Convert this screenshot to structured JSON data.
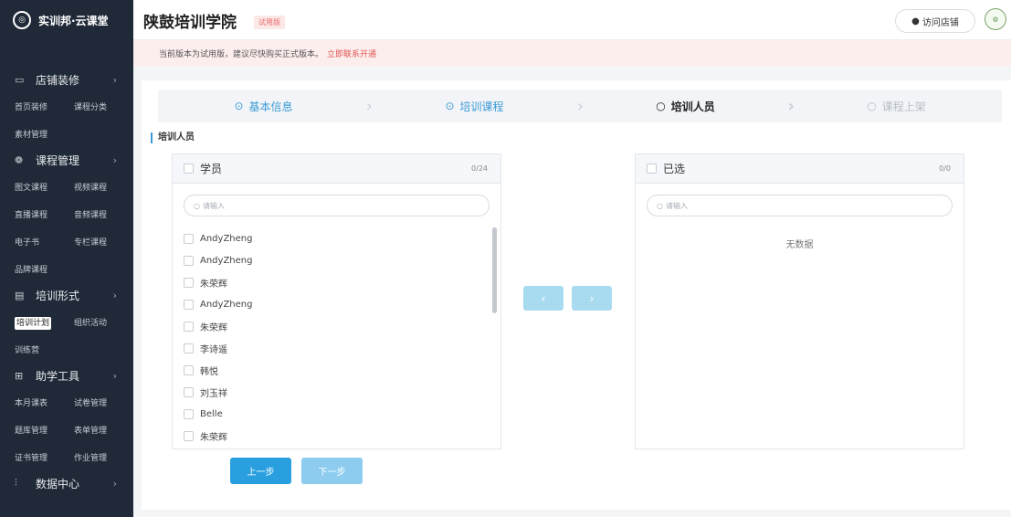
{
  "sidebar": {
    "brand": "实训邦·云课堂",
    "logo_icon": "logo-icon",
    "groups": [
      {
        "label": "店铺装修",
        "icon": "store-icon",
        "items": [
          [
            "首页装修",
            "课程分类"
          ],
          [
            "素材管理"
          ]
        ]
      },
      {
        "label": "课程管理",
        "icon": "course-icon",
        "items": [
          [
            "图文课程",
            "视频课程"
          ],
          [
            "直播课程",
            "音频课程"
          ],
          [
            "电子书",
            "专栏课程"
          ],
          [
            "品牌课程"
          ]
        ]
      },
      {
        "label": "培训形式",
        "icon": "training-icon",
        "items": [
          [
            "培训计划",
            "组织活动"
          ],
          [
            "训练营"
          ]
        ]
      },
      {
        "label": "助学工具",
        "icon": "tools-icon",
        "items": [
          [
            "本月课表",
            "试卷管理"
          ],
          [
            "题库管理",
            "表单管理"
          ],
          [
            "证书管理",
            "作业管理"
          ]
        ]
      },
      {
        "label": "数据中心",
        "icon": "data-icon",
        "items": []
      }
    ],
    "active_item": "培训计划"
  },
  "header": {
    "title": "陕鼓培训学院",
    "badge": "试用版",
    "visit_label": "访问店铺"
  },
  "notice": {
    "text": "当前版本为试用版，建议尽快购买正式版本。",
    "link": "立即联系开通"
  },
  "steps": [
    {
      "label": "基本信息",
      "state": "done"
    },
    {
      "label": "培训课程",
      "state": "done"
    },
    {
      "label": "培训人员",
      "state": "current"
    },
    {
      "label": "课程上架",
      "state": "todo"
    }
  ],
  "section_label": "培训人员",
  "left_panel": {
    "title": "学员",
    "count": "0/24",
    "search_placeholder": "请输入",
    "items": [
      "AndyZheng",
      "AndyZheng",
      "朱荣辉",
      "AndyZheng",
      "朱荣辉",
      "李诗遥",
      "韩悦",
      "刘玉祥",
      "Belle",
      "朱荣辉"
    ]
  },
  "right_panel": {
    "title": "已选",
    "count": "0/0",
    "search_placeholder": "请输入",
    "empty_text": "无数据"
  },
  "transfer": {
    "left_arrow": "‹",
    "right_arrow": "›"
  },
  "buttons": {
    "prev": "上一步",
    "next": "下一步"
  },
  "colors": {
    "accent": "#2a9fe0",
    "sidebar_bg": "#1f2937",
    "notice_link": "#e0554f"
  }
}
